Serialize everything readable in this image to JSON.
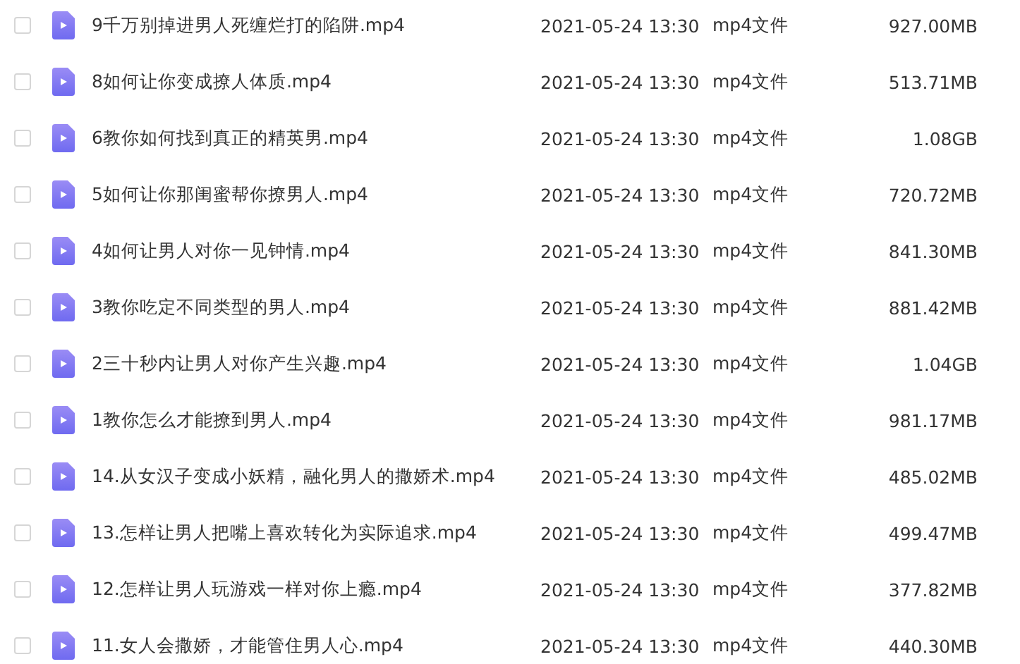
{
  "files": [
    {
      "name": "9千万别掉进男人死缠烂打的陷阱.mp4",
      "modified": "2021-05-24 13:30",
      "type": "mp4文件",
      "size": "927.00MB",
      "checked": false
    },
    {
      "name": "8如何让你变成撩人体质.mp4",
      "modified": "2021-05-24 13:30",
      "type": "mp4文件",
      "size": "513.71MB",
      "checked": false
    },
    {
      "name": "6教你如何找到真正的精英男.mp4",
      "modified": "2021-05-24 13:30",
      "type": "mp4文件",
      "size": "1.08GB",
      "checked": false
    },
    {
      "name": "5如何让你那闺蜜帮你撩男人.mp4",
      "modified": "2021-05-24 13:30",
      "type": "mp4文件",
      "size": "720.72MB",
      "checked": false
    },
    {
      "name": "4如何让男人对你一见钟情.mp4",
      "modified": "2021-05-24 13:30",
      "type": "mp4文件",
      "size": "841.30MB",
      "checked": false
    },
    {
      "name": "3教你吃定不同类型的男人.mp4",
      "modified": "2021-05-24 13:30",
      "type": "mp4文件",
      "size": "881.42MB",
      "checked": false
    },
    {
      "name": "2三十秒内让男人对你产生兴趣.mp4",
      "modified": "2021-05-24 13:30",
      "type": "mp4文件",
      "size": "1.04GB",
      "checked": false
    },
    {
      "name": "1教你怎么才能撩到男人.mp4",
      "modified": "2021-05-24 13:30",
      "type": "mp4文件",
      "size": "981.17MB",
      "checked": false
    },
    {
      "name": "14.从女汉子变成小妖精，融化男人的撒娇术.mp4",
      "modified": "2021-05-24 13:30",
      "type": "mp4文件",
      "size": "485.02MB",
      "checked": false
    },
    {
      "name": "13.怎样让男人把嘴上喜欢转化为实际追求.mp4",
      "modified": "2021-05-24 13:30",
      "type": "mp4文件",
      "size": "499.47MB",
      "checked": false
    },
    {
      "name": "12.怎样让男人玩游戏一样对你上瘾.mp4",
      "modified": "2021-05-24 13:30",
      "type": "mp4文件",
      "size": "377.82MB",
      "checked": false
    },
    {
      "name": "11.女人会撒娇，才能管住男人心.mp4",
      "modified": "2021-05-24 13:30",
      "type": "mp4文件",
      "size": "440.30MB",
      "checked": false
    }
  ]
}
